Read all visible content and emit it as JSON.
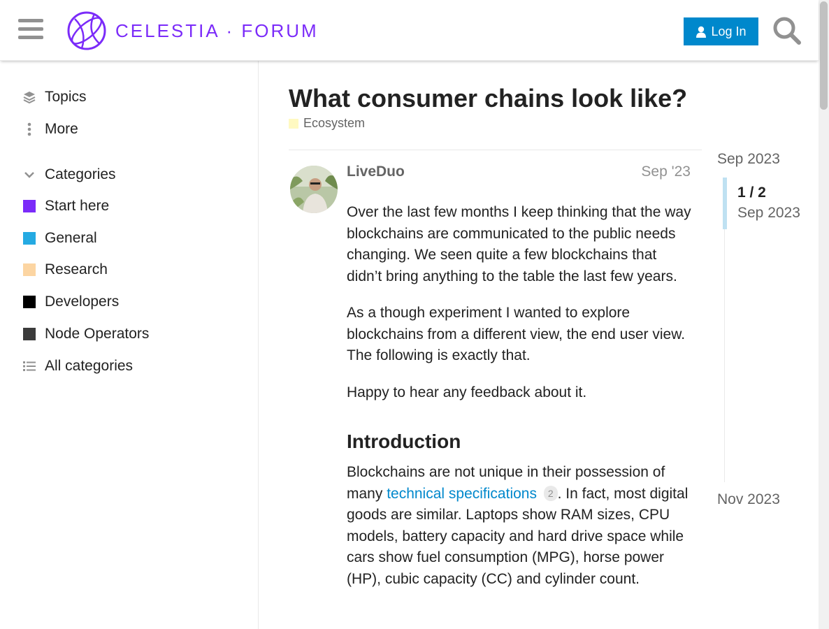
{
  "header": {
    "logo_text": "CELESTIA · FORUM",
    "login_label": "Log In",
    "brand_color": "#7b2bf9",
    "accent_color": "#0088cc"
  },
  "sidebar": {
    "nav": [
      {
        "label": "Topics",
        "icon": "layers-icon"
      },
      {
        "label": "More",
        "icon": "vertical-ellipsis-icon"
      }
    ],
    "categories_header": "Categories",
    "categories": [
      {
        "label": "Start here",
        "color": "#7b2bf9"
      },
      {
        "label": "General",
        "color": "#25aae2"
      },
      {
        "label": "Research",
        "color": "#fcd5a2"
      },
      {
        "label": "Developers",
        "color": "#000000"
      },
      {
        "label": "Node Operators",
        "color": "#3b3b3b"
      }
    ],
    "all_categories_label": "All categories"
  },
  "topic": {
    "title": "What consumer chains look like?",
    "category": "Ecosystem",
    "category_color": "#fff9c1"
  },
  "post": {
    "author": "LiveDuo",
    "date": "Sep '23",
    "paragraphs": [
      "Over the last few months I keep thinking that the way blockchains are communicated to the public needs changing. We seen quite a few blockchains that didn’t bring anything to the table the last few years.",
      "As a though experiment I wanted to explore blockchains from a different view, the end user view. The following is exactly that.",
      "Happy to hear any feedback about it."
    ],
    "heading": "Introduction",
    "intro_before_link": "Blockchains are not unique in their possession of many ",
    "intro_link": "technical specifications",
    "intro_link_clicks": "2",
    "intro_after_link": ". In fact, most digital goods are similar. Laptops show RAM sizes, CPU models, battery capacity and hard drive space while cars show fuel consumption (MPG), horse power (HP), cubic capacity (CC) and cylinder count."
  },
  "timeline": {
    "start": "Sep 2023",
    "position": "1 / 2",
    "position_date": "Sep 2023",
    "end": "Nov 2023"
  }
}
